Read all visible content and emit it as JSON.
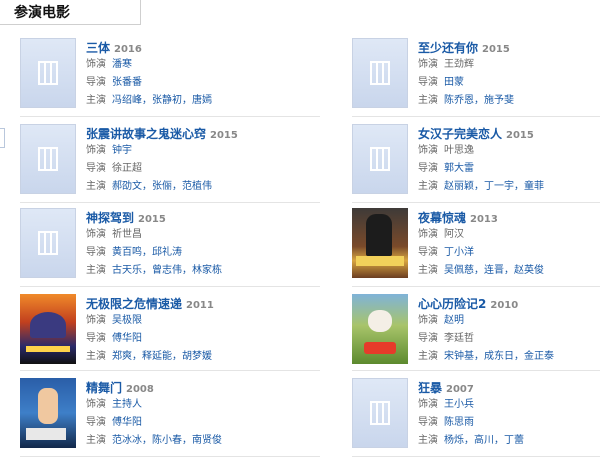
{
  "section_title": "参演电影",
  "films": [
    {
      "title": "三体",
      "year": "2016",
      "poster": "placeholder",
      "role_label": "饰演",
      "role": "潘寒",
      "role_link": true,
      "director_label": "导演",
      "director": "张番番",
      "director_link": true,
      "cast_label": "主演",
      "cast": [
        "冯绍峰",
        "张静初",
        "唐嫣"
      ],
      "cast_link": true
    },
    {
      "title": "至少还有你",
      "year": "2015",
      "poster": "placeholder",
      "role_label": "饰演",
      "role": "王劲辉",
      "role_link": false,
      "director_label": "导演",
      "director": "田蒙",
      "director_link": true,
      "cast_label": "主演",
      "cast": [
        "陈乔恩",
        "施予斐"
      ],
      "cast_link": true
    },
    {
      "title": "张震讲故事之鬼迷心窍",
      "year": "2015",
      "poster": "placeholder",
      "role_label": "饰演",
      "role": "钟宇",
      "role_link": true,
      "director_label": "导演",
      "director": "徐正超",
      "director_link": false,
      "cast_label": "主演",
      "cast": [
        "郝劭文",
        "张俪",
        "范植伟"
      ],
      "cast_link": true
    },
    {
      "title": "女汉子完美恋人",
      "year": "2015",
      "poster": "placeholder",
      "role_label": "饰演",
      "role": "叶思逸",
      "role_link": false,
      "director_label": "导演",
      "director": "郭大雷",
      "director_link": true,
      "cast_label": "主演",
      "cast": [
        "赵丽颖",
        "丁一宇",
        "童菲"
      ],
      "cast_link": true
    },
    {
      "title": "神探驾到",
      "year": "2015",
      "poster": "placeholder",
      "role_label": "饰演",
      "role": "祈世昌",
      "role_link": false,
      "director_label": "导演",
      "director": "黄百鸣",
      "director_link": true,
      "director_extra": "邱礼涛",
      "cast_label": "主演",
      "cast": [
        "古天乐",
        "曾志伟",
        "林家栋"
      ],
      "cast_link": true
    },
    {
      "title": "夜幕惊魂",
      "year": "2013",
      "poster": "spy",
      "role_label": "饰演",
      "role": "阿汉",
      "role_link": false,
      "director_label": "导演",
      "director": "丁小洋",
      "director_link": true,
      "cast_label": "主演",
      "cast": [
        "吴佩慈",
        "连晋",
        "赵英俊"
      ],
      "cast_link": true
    },
    {
      "title": "无极限之危情速递",
      "year": "2011",
      "poster": "speed",
      "role_label": "饰演",
      "role": "吴极限",
      "role_link": true,
      "director_label": "导演",
      "director": "傅华阳",
      "director_link": true,
      "cast_label": "主演",
      "cast": [
        "郑爽",
        "释延能",
        "胡梦媛"
      ],
      "cast_link": true
    },
    {
      "title": "心心历险记2",
      "year": "2010",
      "poster": "dog",
      "role_label": "饰演",
      "role": "赵明",
      "role_link": true,
      "director_label": "导演",
      "director": "李廷哲",
      "director_link": false,
      "cast_label": "主演",
      "cast": [
        "宋钟基",
        "成东日",
        "金正泰"
      ],
      "cast_link": true
    },
    {
      "title": "精舞门",
      "year": "2008",
      "poster": "dance",
      "role_label": "饰演",
      "role": "主持人",
      "role_link": true,
      "director_label": "导演",
      "director": "傅华阳",
      "director_link": true,
      "cast_label": "主演",
      "cast": [
        "范冰冰",
        "陈小春",
        "南贤俊"
      ],
      "cast_link": true
    },
    {
      "title": "狂暴",
      "year": "2007",
      "poster": "placeholder",
      "role_label": "饰演",
      "role": "王小兵",
      "role_link": true,
      "director_label": "导演",
      "director": "陈思雨",
      "director_link": true,
      "cast_label": "主演",
      "cast": [
        "杨烁",
        "高川",
        "丁蕾"
      ],
      "cast_link": true
    }
  ]
}
